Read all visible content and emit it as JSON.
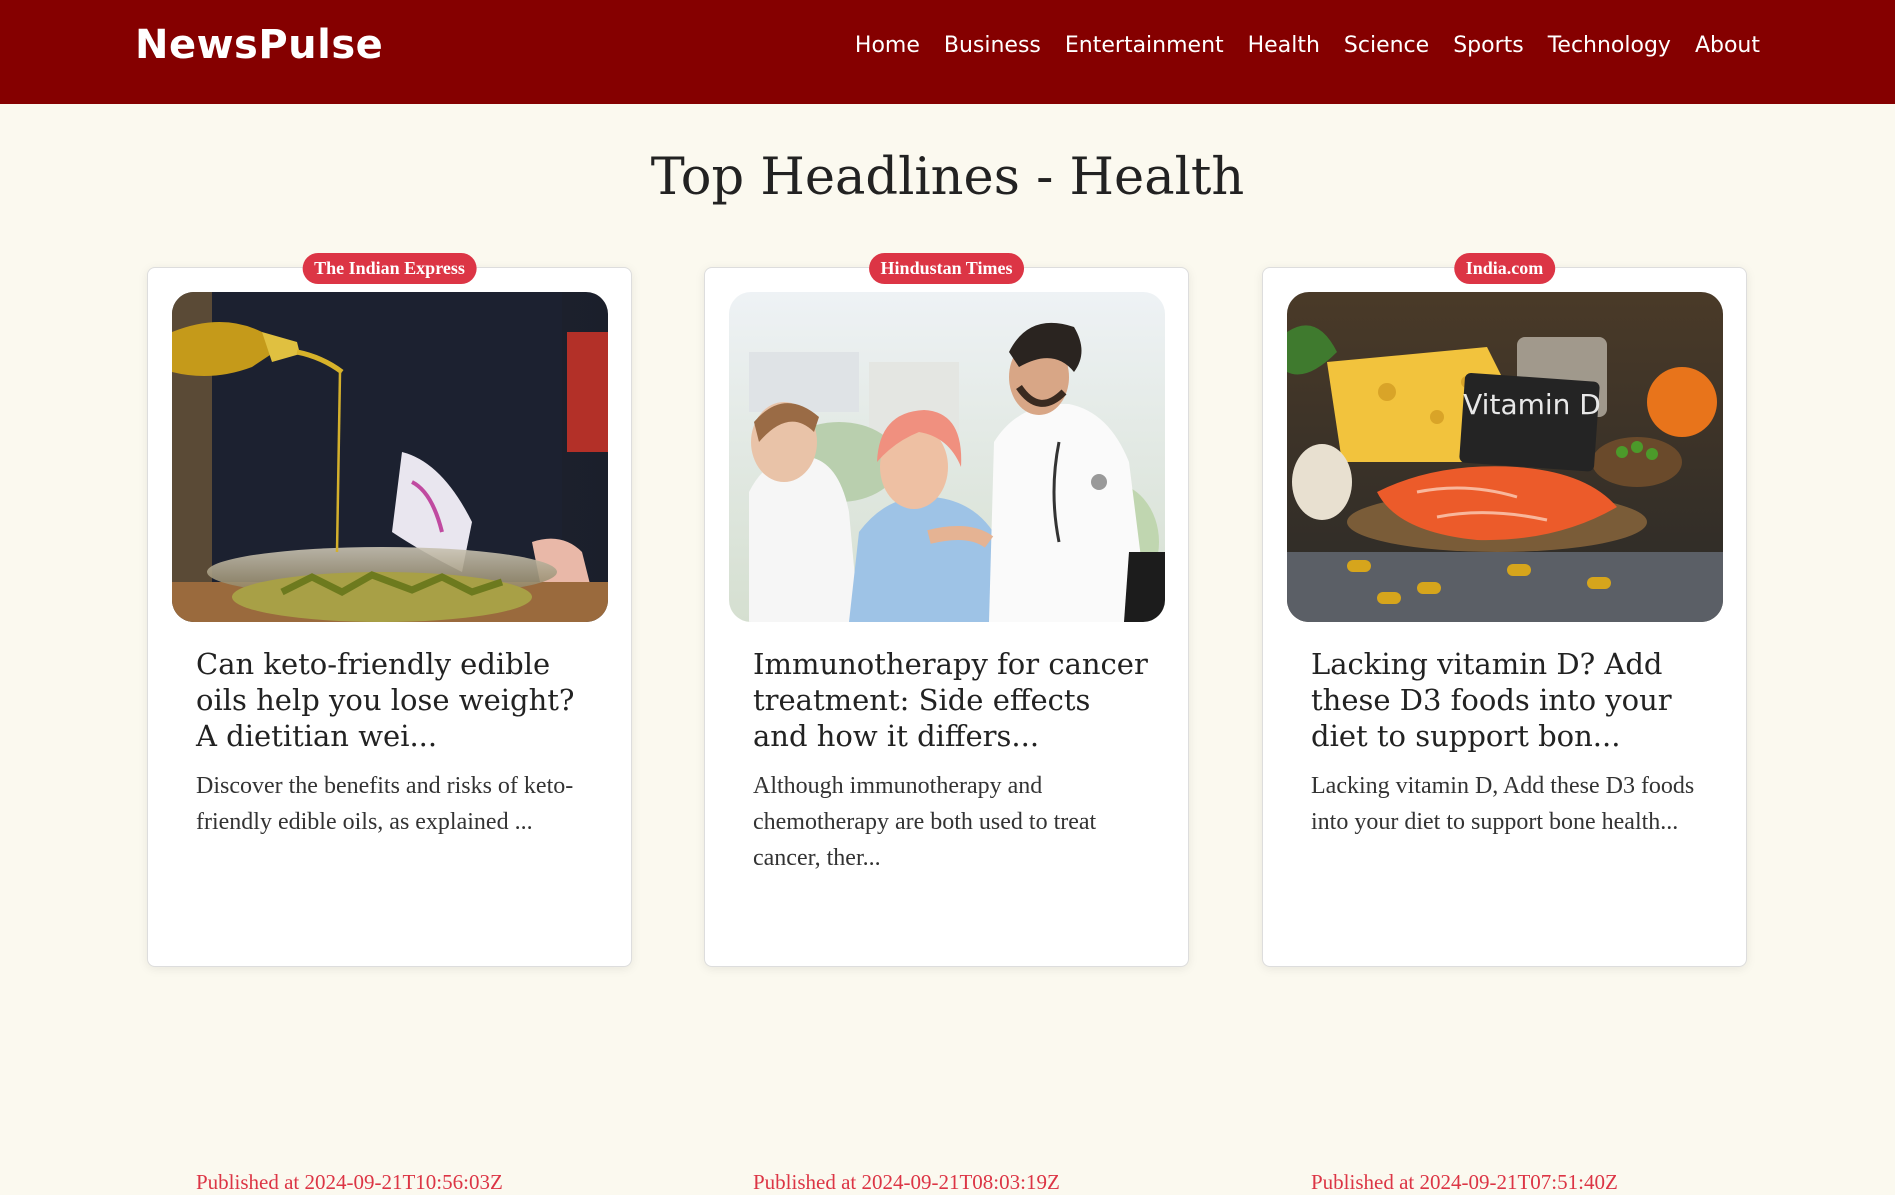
{
  "brand": "NewsPulse",
  "nav": [
    "Home",
    "Business",
    "Entertainment",
    "Health",
    "Science",
    "Sports",
    "Technology",
    "About"
  ],
  "page_title": "Top Headlines - Health",
  "colors": {
    "navbar": "#850000",
    "background": "#fbf9ef",
    "badge": "#dc3545",
    "date": "#dc3545"
  },
  "articles": [
    {
      "source": "The Indian Express",
      "title": "Can keto-friendly edible oils help you lose weight? A dietitian wei...",
      "description": "Discover the benefits and risks of keto-friendly edible oils, as explained ...",
      "published": "Published at 2024-09-21T10:56:03Z",
      "image": "olive-oil-pouring-photo"
    },
    {
      "source": "Hindustan Times",
      "title": "Immunotherapy for cancer treatment: Side effects and how it differs...",
      "description": "Although immunotherapy and chemotherapy are both used to treat cancer, ther...",
      "published": "Published at 2024-09-21T08:03:19Z",
      "image": "doctors-with-patient-photo"
    },
    {
      "source": "India.com",
      "title": "Lacking vitamin D? Add these D3 foods into your diet to support bon...",
      "description": "Lacking vitamin D, Add these D3 foods into your diet to support bone health...",
      "published": "Published at 2024-09-21T07:51:40Z",
      "image": "vitamin-d-foods-photo",
      "image_text": "Vitamin D"
    }
  ]
}
